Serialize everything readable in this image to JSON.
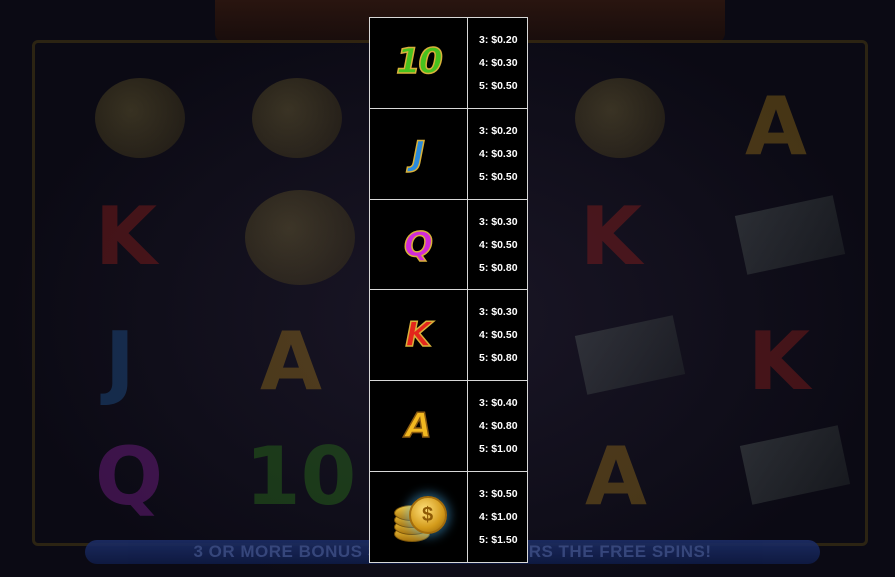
{
  "banner_text": "3 OR MORE BONUS SYMBOLS TRIGGERS THE FREE SPINS!",
  "paytable": [
    {
      "symbol": "10",
      "icon": "ten-symbol-icon",
      "pays": [
        "3: $0.20",
        "4: $0.30",
        "5: $0.50"
      ]
    },
    {
      "symbol": "J",
      "icon": "jack-symbol-icon",
      "pays": [
        "3: $0.20",
        "4: $0.30",
        "5: $0.50"
      ]
    },
    {
      "symbol": "Q",
      "icon": "queen-symbol-icon",
      "pays": [
        "3: $0.30",
        "4: $0.50",
        "5: $0.80"
      ]
    },
    {
      "symbol": "K",
      "icon": "king-symbol-icon",
      "pays": [
        "3: $0.30",
        "4: $0.50",
        "5: $0.80"
      ]
    },
    {
      "symbol": "A",
      "icon": "ace-symbol-icon",
      "pays": [
        "3: $0.40",
        "4: $0.80",
        "5: $1.00"
      ]
    },
    {
      "symbol": "",
      "icon": "gold-coin-stack-icon",
      "pays": [
        "3: $0.50",
        "4: $1.00",
        "5: $1.50"
      ]
    }
  ],
  "colors": {
    "ten": "#47c21d",
    "jack": "#2a8bdc",
    "queen": "#d12ad8",
    "king": "#e3261c",
    "ace": "#f2b820",
    "border": "#d8d8d8"
  }
}
